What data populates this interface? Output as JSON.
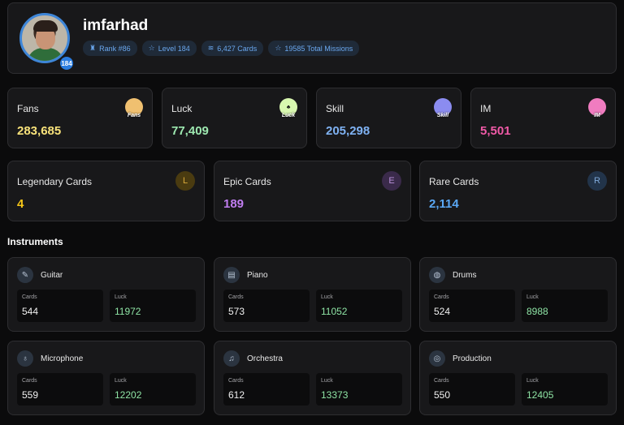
{
  "profile": {
    "username": "imfarhad",
    "avatar_level": "184",
    "pills": [
      {
        "icon": "trophy-icon",
        "glyph": "🏆",
        "label": "Rank #86"
      },
      {
        "icon": "star-icon",
        "glyph": "☆",
        "label": "Level 184"
      },
      {
        "icon": "layers-icon",
        "glyph": "≋",
        "label": "6,427 Cards"
      },
      {
        "icon": "star-icon",
        "glyph": "☆",
        "label": "19585 Total Missions"
      }
    ]
  },
  "stats": [
    {
      "label": "Fans",
      "value": "283,685",
      "color": "#f8e27a",
      "badge_text": "Fans",
      "badge_color": "#f0c070"
    },
    {
      "label": "Luck",
      "value": "77,409",
      "color": "#9de8b0",
      "badge_text": "Luck",
      "badge_color": "#d8f7b0"
    },
    {
      "label": "Skill",
      "value": "205,298",
      "color": "#7fb2f3",
      "badge_text": "Skill",
      "badge_color": "#8b8cf0"
    },
    {
      "label": "IM",
      "value": "5,501",
      "color": "#f05aa7",
      "badge_text": "IM",
      "badge_color": "#f07cc0"
    }
  ],
  "rarities": [
    {
      "label": "Legendary Cards",
      "value": "4",
      "letter": "L",
      "color": "#f5c518",
      "letter_bg": "#4a3b10",
      "letter_color": "#d8a83a"
    },
    {
      "label": "Epic Cards",
      "value": "189",
      "letter": "E",
      "color": "#c07df0",
      "letter_bg": "#3a2a4a",
      "letter_color": "#b890d8"
    },
    {
      "label": "Rare Cards",
      "value": "2,114",
      "letter": "R",
      "color": "#5aa8f5",
      "letter_bg": "#22344a",
      "letter_color": "#7fa8d8"
    }
  ],
  "instruments_title": "Instruments",
  "instruments": [
    {
      "name": "Guitar",
      "icon": "guitar-icon",
      "glyph": "🎸",
      "cards_label": "Cards",
      "cards": "544",
      "luck_label": "Luck",
      "luck": "11972"
    },
    {
      "name": "Piano",
      "icon": "piano-icon",
      "glyph": "🎹",
      "cards_label": "Cards",
      "cards": "573",
      "luck_label": "Luck",
      "luck": "11052"
    },
    {
      "name": "Drums",
      "icon": "drums-icon",
      "glyph": "🥁",
      "cards_label": "Cards",
      "cards": "524",
      "luck_label": "Luck",
      "luck": "8988"
    },
    {
      "name": "Microphone",
      "icon": "microphone-icon",
      "glyph": "🎙",
      "cards_label": "Cards",
      "cards": "559",
      "luck_label": "Luck",
      "luck": "12202"
    },
    {
      "name": "Orchestra",
      "icon": "music-note-icon",
      "glyph": "♫",
      "cards_label": "Cards",
      "cards": "612",
      "luck_label": "Luck",
      "luck": "13373"
    },
    {
      "name": "Production",
      "icon": "disc-icon",
      "glyph": "◎",
      "cards_label": "Cards",
      "cards": "550",
      "luck_label": "Luck",
      "luck": "12405"
    }
  ]
}
